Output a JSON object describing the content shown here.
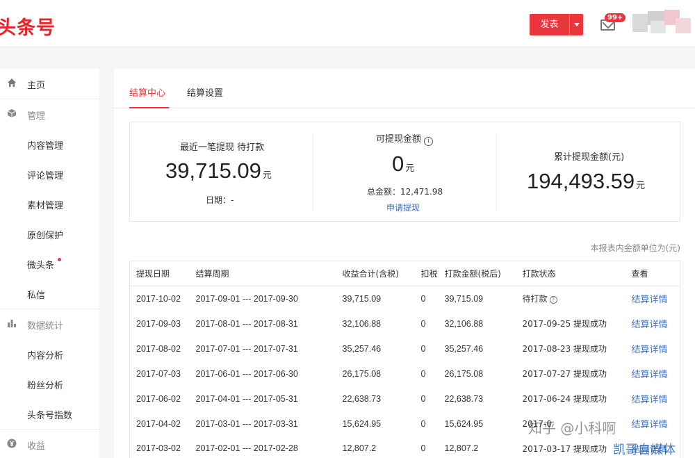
{
  "header": {
    "logo": "头条号",
    "publish_label": "发表",
    "mail_badge": "99+",
    "icons": [
      "caret-down-icon",
      "mail-icon",
      "avatar"
    ]
  },
  "sidebar": {
    "items": [
      {
        "label": "主页",
        "icon": "home-icon",
        "kind": "nav"
      },
      {
        "label": "管理",
        "icon": "cube-icon",
        "kind": "group"
      },
      {
        "label": "内容管理",
        "kind": "sub"
      },
      {
        "label": "评论管理",
        "kind": "sub"
      },
      {
        "label": "素材管理",
        "kind": "sub"
      },
      {
        "label": "原创保护",
        "kind": "sub"
      },
      {
        "label": "微头条",
        "kind": "sub",
        "has_dot": true
      },
      {
        "label": "私信",
        "kind": "sub"
      },
      {
        "label": "数据统计",
        "icon": "bar-chart-icon",
        "kind": "group"
      },
      {
        "label": "内容分析",
        "kind": "sub"
      },
      {
        "label": "粉丝分析",
        "kind": "sub"
      },
      {
        "label": "头条号指数",
        "kind": "sub"
      },
      {
        "label": "收益",
        "icon": "yen-icon",
        "kind": "group"
      }
    ]
  },
  "tabs": [
    {
      "label": "结算中心",
      "active": true
    },
    {
      "label": "结算设置",
      "active": false
    }
  ],
  "summary": {
    "recent": {
      "label": "最近一笔提现 待打款",
      "amount": "39,715.09",
      "unit": "元",
      "date_label": "日期：-"
    },
    "available": {
      "label": "可提现金额",
      "amount": "0",
      "unit": "元",
      "total_label": "总金额：12,471.98",
      "withdraw_link": "申请提现"
    },
    "cumulative": {
      "label": "累计提现金额(元)",
      "amount": "194,493.59",
      "unit": "元"
    }
  },
  "unit_note": "本报表内金额单位为(元)",
  "table": {
    "columns": [
      "提现日期",
      "结算周期",
      "收益合计(含税)",
      "扣税",
      "打款金额(税后)",
      "打款状态",
      "查看"
    ],
    "rows": [
      {
        "date": "2017-10-02",
        "period": "2017-09-01 --- 2017-09-30",
        "income": "39,715.09",
        "tax": "0",
        "paid": "39,715.09",
        "status": "待打款",
        "status_help": true,
        "view": "结算详情"
      },
      {
        "date": "2017-09-03",
        "period": "2017-08-01 --- 2017-08-31",
        "income": "32,106.88",
        "tax": "0",
        "paid": "32,106.88",
        "status": "2017-09-25 提现成功",
        "view": "结算详情"
      },
      {
        "date": "2017-08-02",
        "period": "2017-07-01 --- 2017-07-31",
        "income": "35,257.46",
        "tax": "0",
        "paid": "35,257.46",
        "status": "2017-08-23 提现成功",
        "view": "结算详情"
      },
      {
        "date": "2017-07-03",
        "period": "2017-06-01 --- 2017-06-30",
        "income": "26,175.08",
        "tax": "0",
        "paid": "26,175.08",
        "status": "2017-07-27 提现成功",
        "view": "结算详情"
      },
      {
        "date": "2017-06-02",
        "period": "2017-04-01 --- 2017-05-31",
        "income": "22,638.73",
        "tax": "0",
        "paid": "22,638.73",
        "status": "2017-06-24 提现成功",
        "view": "结算详情"
      },
      {
        "date": "2017-04-02",
        "period": "2017-03-01 --- 2017-03-31",
        "income": "15,624.95",
        "tax": "0",
        "paid": "15,624.95",
        "status": "2017-0",
        "view": "结算详情"
      },
      {
        "date": "2017-03-02",
        "period": "2017-02-01 --- 2017-02-28",
        "income": "12,807.2",
        "tax": "0",
        "paid": "12,807.2",
        "status": "2017-03-17 提现成功",
        "view": "结算详情"
      }
    ]
  },
  "watermarks": {
    "zhihu": "知乎 @小科啊",
    "kaige": "凯哥自媒体"
  },
  "colors": {
    "accent": "#e8363c",
    "link": "#3b73c7"
  }
}
